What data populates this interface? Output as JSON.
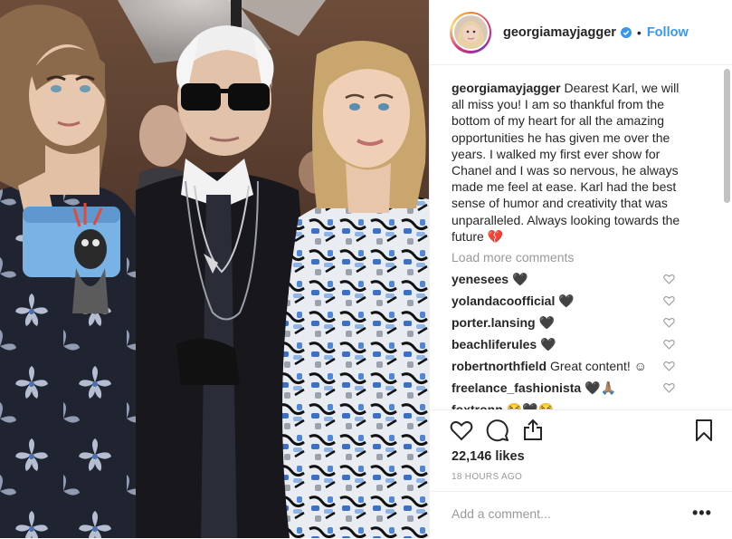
{
  "post": {
    "username": "georgiamayjagger",
    "follow_label": "Follow",
    "separator": "•",
    "caption_user": "georgiamayjagger",
    "caption_text": "Dearest Karl, we will all miss you! I am so thankful from the bottom of my heart for all the amazing opportunities he has given me over the years. I walked my first ever show for Chanel and I was so nervous, he always made me feel at ease. Karl had the best sense of humor and creativity that was unparalleled. Always looking towards the future 💔",
    "load_more_label": "Load more comments",
    "comments": [
      {
        "user": "yenesees",
        "text": "🖤"
      },
      {
        "user": "yolandacoofficial",
        "text": "🖤"
      },
      {
        "user": "porter.lansing",
        "text": "🖤"
      },
      {
        "user": "beachliferules",
        "text": "🖤"
      },
      {
        "user": "robertnorthfield",
        "text": "Great content! ☺"
      },
      {
        "user": "freelance_fashionista",
        "text": "🖤🙏🏽"
      },
      {
        "user": "foxtronn",
        "text": "😂🖤😂"
      }
    ],
    "likes": "22,146 likes",
    "timestamp": "18 HOURS AGO",
    "add_comment_placeholder": "Add a comment...",
    "more_label": "•••"
  },
  "icons": {
    "like": "heart-icon",
    "comment": "comment-icon",
    "share": "share-icon",
    "save": "bookmark-icon",
    "verified": "verified-badge-icon"
  },
  "colors": {
    "link": "#3897f0",
    "text": "#262626",
    "muted": "#999999",
    "border": "#efefef"
  }
}
